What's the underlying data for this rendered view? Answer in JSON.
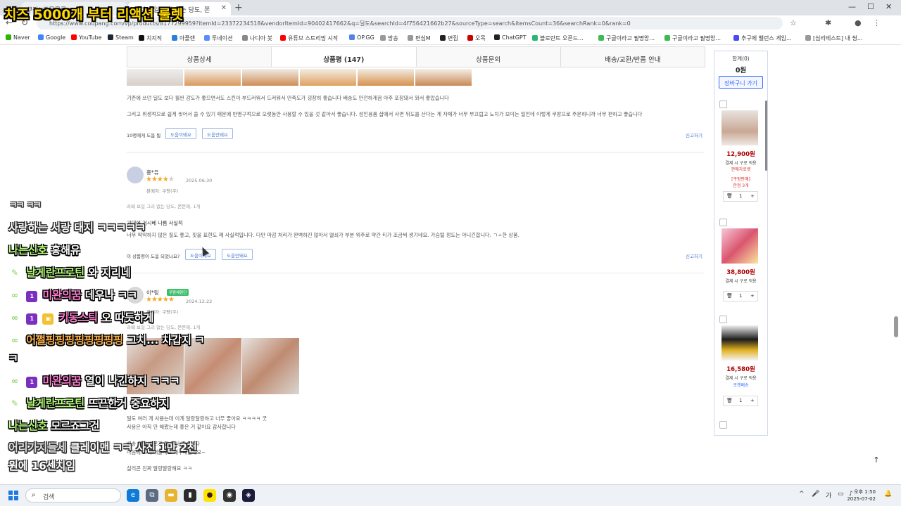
{
  "stream": {
    "title": "치즈 5000개 부터 리액션 룰렛"
  },
  "browser": {
    "tabs": [
      {
        "title": "쿠팡! 주문목록"
      },
      {
        "title": "라떼 보일 그리 없는 당도, 쫀"
      }
    ],
    "url": "https://www.coupang.com/vp/products/8177299959?itemId=23372234518&vendorItemId=90402417662&q=딜도&searchId=4f756421662b27&sourceType=search&itemsCount=36&searchRank=0&rank=0",
    "bookmarks": [
      "Naver",
      "Google",
      "YouTube",
      "Steam",
      "치지직",
      "아플랜",
      "투네이션",
      "나디아 봇",
      "유튜브 스트리밍 시작",
      "OP.GG",
      "방송",
      "편심M",
      "편집",
      "오목",
      "ChatGPT",
      "블로란트 오픈드...",
      "구글이라고 필명앙...",
      "구글이라고 필명앙...",
      "추구에 밸런스 게임...",
      "[심리테스트] 내 씽..."
    ]
  },
  "product_tabs": [
    "상품상세",
    "상품평 (147)",
    "상품문의",
    "배송/교환/반품 안내"
  ],
  "reviews": [
    {
      "text_lines": [
        "기존에 쓰던 딜도 보다 훨씬 강도가 좋으면서도 스킨이 부드러워서 드러워서 만족도가 굉장히 좋습니다 배송도 안전하게끔 아주 포장돼서 와서 좋았습니다",
        "그리고 위생적으로 쉽게 씻어서 쓸 수 있기 때문에 반영구적으로 오랫동안 사용할 수 있을 것 같아서 좋습니다. 성인용품 샵에서 사면 뒤도를 산다는 게 자체가 너무 부끄럽고 노치가 보이는 일인데 이렇게 쿠팡으로 주문하니까 너무 편하고 좋습니다"
      ],
      "help_count_label": "10명에게 도움 됨",
      "help_yes": "도움이돼요",
      "help_no": "도움안돼요",
      "report": "신고하기"
    },
    {
      "name": "홍*유",
      "stars": 4,
      "date": "2025.06.30",
      "seller": "판매자: 쿠팡(주)",
      "option": "라떼 보일 그리 없는 당도, 쫀쫀해, 1개",
      "headline": "기대에 거시베 나름 사실적",
      "text": "너무 딱딱하지 않은 질도 좋고, 핏을 표현도 꽤 사실적입니다. 다만 마감 처리가 완벽하진 않아서 열쇠가 부분 위주로 약간 티가 조금씩 생기네요. 가슴털 정도는 아니긴합니다. ㄱㅅ한 상품.",
      "help_label": "이 상품평이 도움 되었나요?",
      "help_yes": "도움이돼요",
      "help_no": "도움안돼요",
      "report": "신고하기"
    },
    {
      "name": "이*림",
      "badge": "쿠팡체험단",
      "stars": 5,
      "date": "2024.12.22",
      "seller": "판매자: 쿠팡(주)",
      "option": "라떼 보일 그리 없는 당도, 쫀쫀해, 1개",
      "text_lines": [
        "딜도 여러 개 사용는데 이게 달랑달랑하고 너무 좋아요 ㅋㅋㅋㅋ 굿",
        "사용은 아직 안 해봤는데 좋은 거 같아요 감사합니다",
        "배송 정말 빠르게 잘 와서 좋습니다",
        "다음에 또 구매할게요 재구매할게요~",
        "실리콘 진짜 말랑말랑해요 ㅋㅋ"
      ]
    }
  ],
  "cart": {
    "sum_label": "합계(0)",
    "sum": "0원",
    "go_button": "장바구니 가기",
    "items": [
      {
        "price": "12,900원",
        "delivery": "결제 시 구로 적용",
        "tag": "판매자로켓",
        "extra1": "[쿠팡판매]",
        "extra2": "한정 3개",
        "qty": "1"
      },
      {
        "price": "38,800원",
        "delivery": "결제 시 구로 적용",
        "qty": "1"
      },
      {
        "price": "16,580원",
        "delivery": "결제 시 구로 적용",
        "tag": "로켓배송",
        "qty": "1"
      }
    ]
  },
  "chat": [
    {
      "nick": "",
      "msg": "ㅋㅋ ㅋㅋ"
    },
    {
      "nick": "",
      "msg": "사랑하는 서랑 태지 ㅋㅋㅋㅋㅋ"
    },
    {
      "nick": "나는신호",
      "msg": "홍해유"
    },
    {
      "nick": "날게란프로틴",
      "msg": "와 지리네"
    },
    {
      "nick": "미완의꿈",
      "msg": "데우나 ㅋㅋ"
    },
    {
      "nick": "키동스틱",
      "msg": "오 따듯하게"
    },
    {
      "nick": "어쩔핑핑핑핑핑핑핑핑",
      "msg": "그치... 차갑지 ㅋ"
    },
    {
      "nick": "",
      "msg": "ㅋ"
    },
    {
      "nick": "미완의꿈",
      "msg": "열이 나긴하지 ㅋㅋㅋ"
    },
    {
      "nick": "날게란프로틴",
      "msg": "뜨끈한거 중요하지"
    },
    {
      "nick": "나는신호",
      "msg": "모르죠그건"
    },
    {
      "nick": "어리가지들세",
      "msg": "클레이맨 ㅋㅋ 사진 1만 2천"
    },
    {
      "nick": "",
      "msg": "원에 16센치임"
    }
  ],
  "taskbar": {
    "search": "검색",
    "time": "오후 1:50",
    "date": "2025-07-02"
  }
}
